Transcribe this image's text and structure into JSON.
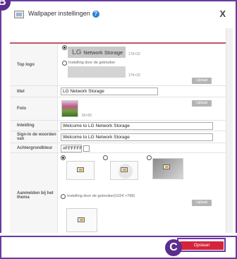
{
  "callouts": {
    "b": "B",
    "c": "C"
  },
  "header": {
    "title": "Wallpaper instellingen",
    "help_icon": "question-icon",
    "close_label": "X"
  },
  "form": {
    "top_logo": {
      "label": "Top logo",
      "logo_text_lg": "LG",
      "logo_text_ns": "Network Storage",
      "logo_size": "176×32",
      "user_option": "Instelling door de gebruiker",
      "user_size": "176×32",
      "upload": "Upload"
    },
    "title": {
      "label": "titel",
      "value": "LG Network Storage"
    },
    "photo": {
      "label": "Foto",
      "size": "50×50",
      "upload": "Upload"
    },
    "intro": {
      "label": "Inleiding",
      "value": "Welcome to LG Network Storage"
    },
    "signin": {
      "label": "Sign-in de woorden van",
      "value": "Welcome to LG Network Storage"
    },
    "bgcolor": {
      "label": "Achtergrondkleur",
      "value": "#FFFFFF"
    },
    "theme": {
      "label": "Aanmelden bij het thema",
      "user_option": "Instelling door de gebruiker(1024 ×768)",
      "upload": "Upload"
    }
  },
  "footer": {
    "save_label": "Opslaan"
  },
  "colors": {
    "accent": "#d4243c",
    "frame": "#6a3aa0",
    "section_line": "#c0566a"
  }
}
